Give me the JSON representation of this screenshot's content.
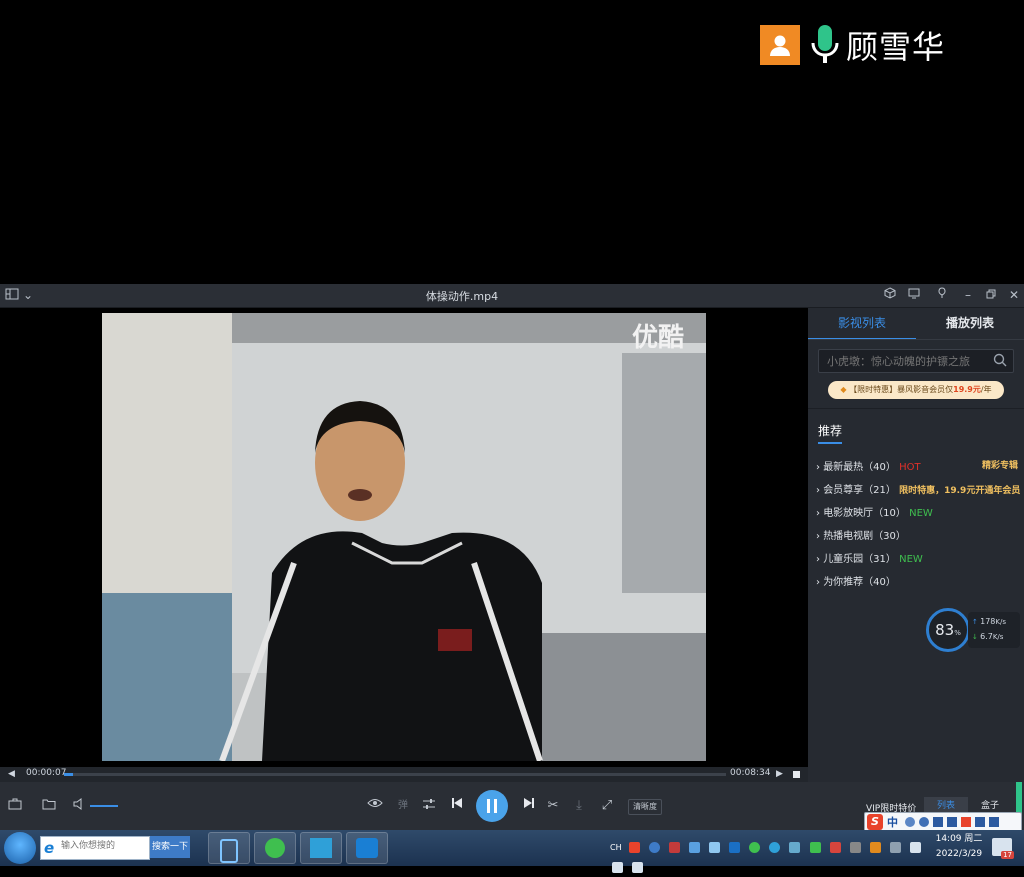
{
  "overlay": {
    "streamer_name": "顾雪华"
  },
  "window": {
    "title": "体操动作.mp4"
  },
  "video": {
    "watermark": "优酷"
  },
  "panel": {
    "tabs": [
      {
        "label": "影视列表",
        "active": true
      },
      {
        "label": "播放列表",
        "active": false
      }
    ],
    "search_placeholder": "小虎墩：惊心动魄的护镖之旅",
    "promo": {
      "text": "【限时特惠】暴风影音会员仅",
      "price": "19.9元",
      "unit": "/年"
    },
    "recommend_title": "推荐",
    "featured_label": "精彩专辑",
    "items": [
      {
        "label": "最新最热（40）",
        "tag": "HOT",
        "tag_type": "hot"
      },
      {
        "label": "会员尊享（21）",
        "tag": "限时特惠，19.9元开通年会员",
        "tag_type": "gold"
      },
      {
        "label": "电影放映厅（10）",
        "tag": "NEW",
        "tag_type": "new"
      },
      {
        "label": "热播电视剧（30）",
        "tag": "",
        "tag_type": ""
      },
      {
        "label": "儿童乐园（31）",
        "tag": "NEW",
        "tag_type": "new"
      },
      {
        "label": "为你推荐（40）",
        "tag": "",
        "tag_type": ""
      }
    ]
  },
  "speed": {
    "percent": "83",
    "percent_unit": "%",
    "up": "178",
    "up_unit": "K/s",
    "down": "6.7",
    "down_unit": "K/s"
  },
  "playback": {
    "current_time": "00:00:07",
    "total_time": "00:08:34",
    "progress": 0.014
  },
  "controls": {
    "danmaku_label": "弹",
    "quality_label": "清晰度",
    "vip_label": "VIP限时特价",
    "list_label": "列表",
    "box_label": "盒子"
  },
  "taskbar": {
    "ie_placeholder": "输入你想搜的",
    "search_button": "搜索一下",
    "lang": "CH",
    "time": "14:09 周二",
    "date": "2022/3/29",
    "notif_count": "17"
  },
  "ime": {
    "lang": "中"
  },
  "colors": {
    "accent": "#3a8ee6",
    "hot": "#e0302a",
    "new": "#3fbf4f",
    "gold": "#f0c060",
    "brand_orange": "#f08a24"
  }
}
